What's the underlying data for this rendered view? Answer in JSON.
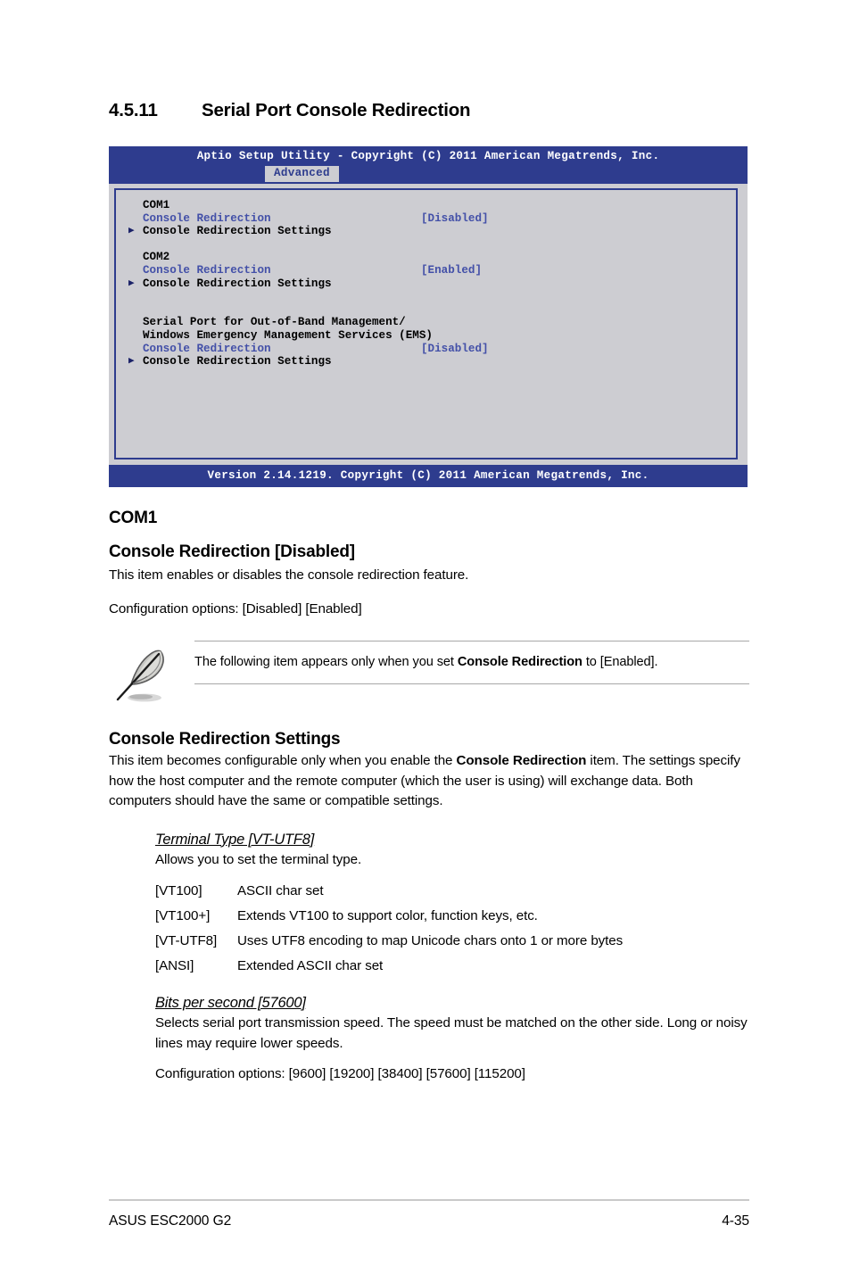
{
  "section": {
    "number": "4.5.11",
    "title": "Serial Port Console Redirection"
  },
  "bios": {
    "header_title": "Aptio Setup Utility - Copyright (C) 2011 American Megatrends, Inc.",
    "active_tab": "Advanced",
    "footer": "Version 2.14.1219. Copyright (C) 2011 American Megatrends, Inc.",
    "colors": {
      "bar_blue": "#2e3c8e",
      "panel_gray": "#cdcdd2",
      "item_blue": "#4350a8"
    },
    "groups": [
      {
        "group_label": "COM1",
        "redirection_label": "Console Redirection",
        "redirection_value": "[Disabled]",
        "settings_label": "Console Redirection Settings"
      },
      {
        "group_label": "COM2",
        "redirection_label": "Console Redirection",
        "redirection_value": "[Enabled]",
        "settings_label": "Console Redirection Settings"
      }
    ],
    "ems": {
      "title_line1": "Serial Port for Out-of-Band Management/",
      "title_line2": "Windows Emergency Management Services (EMS)",
      "redirection_label": "Console Redirection",
      "redirection_value": "[Disabled]",
      "settings_label": "Console Redirection Settings"
    }
  },
  "com1": {
    "heading": "COM1",
    "item_heading": "Console Redirection [Disabled]",
    "description": "This item enables or disables the console redirection feature.",
    "config_options": "Configuration options: [Disabled] [Enabled]"
  },
  "note": {
    "icon": "quill-pen-icon",
    "text_before": "The following item appears only when you set ",
    "text_bold": "Console Redirection",
    "text_after": " to [Enabled]."
  },
  "settings": {
    "heading": "Console Redirection Settings",
    "desc_part1": "This item becomes configurable only when you enable the ",
    "desc_bold": "Console Redirection",
    "desc_part2": " item. The settings specify how the host computer and the remote computer (which the user is using) will exchange data. Both computers should have the same or compatible settings."
  },
  "terminal_type": {
    "title": "Terminal Type [VT-UTF8]",
    "description": "Allows you to set the terminal type.",
    "options": [
      {
        "key": "[VT100]",
        "value": "ASCII char set"
      },
      {
        "key": "[VT100+]",
        "value": "Extends VT100 to support color, function keys, etc."
      },
      {
        "key": "[VT-UTF8]",
        "value": "Uses UTF8 encoding to map Unicode chars onto 1 or more bytes"
      },
      {
        "key": "[ANSI]",
        "value": "Extended ASCII char set"
      }
    ]
  },
  "bits_per_second": {
    "title": "Bits per second [57600]",
    "description": "Selects serial port transmission speed. The speed must be matched on the other side. Long or noisy lines may require lower speeds.",
    "config_options": "Configuration options: [9600] [19200] [38400] [57600] [115200]"
  },
  "footer": {
    "product": "ASUS ESC2000 G2",
    "page_number": "4-35"
  }
}
